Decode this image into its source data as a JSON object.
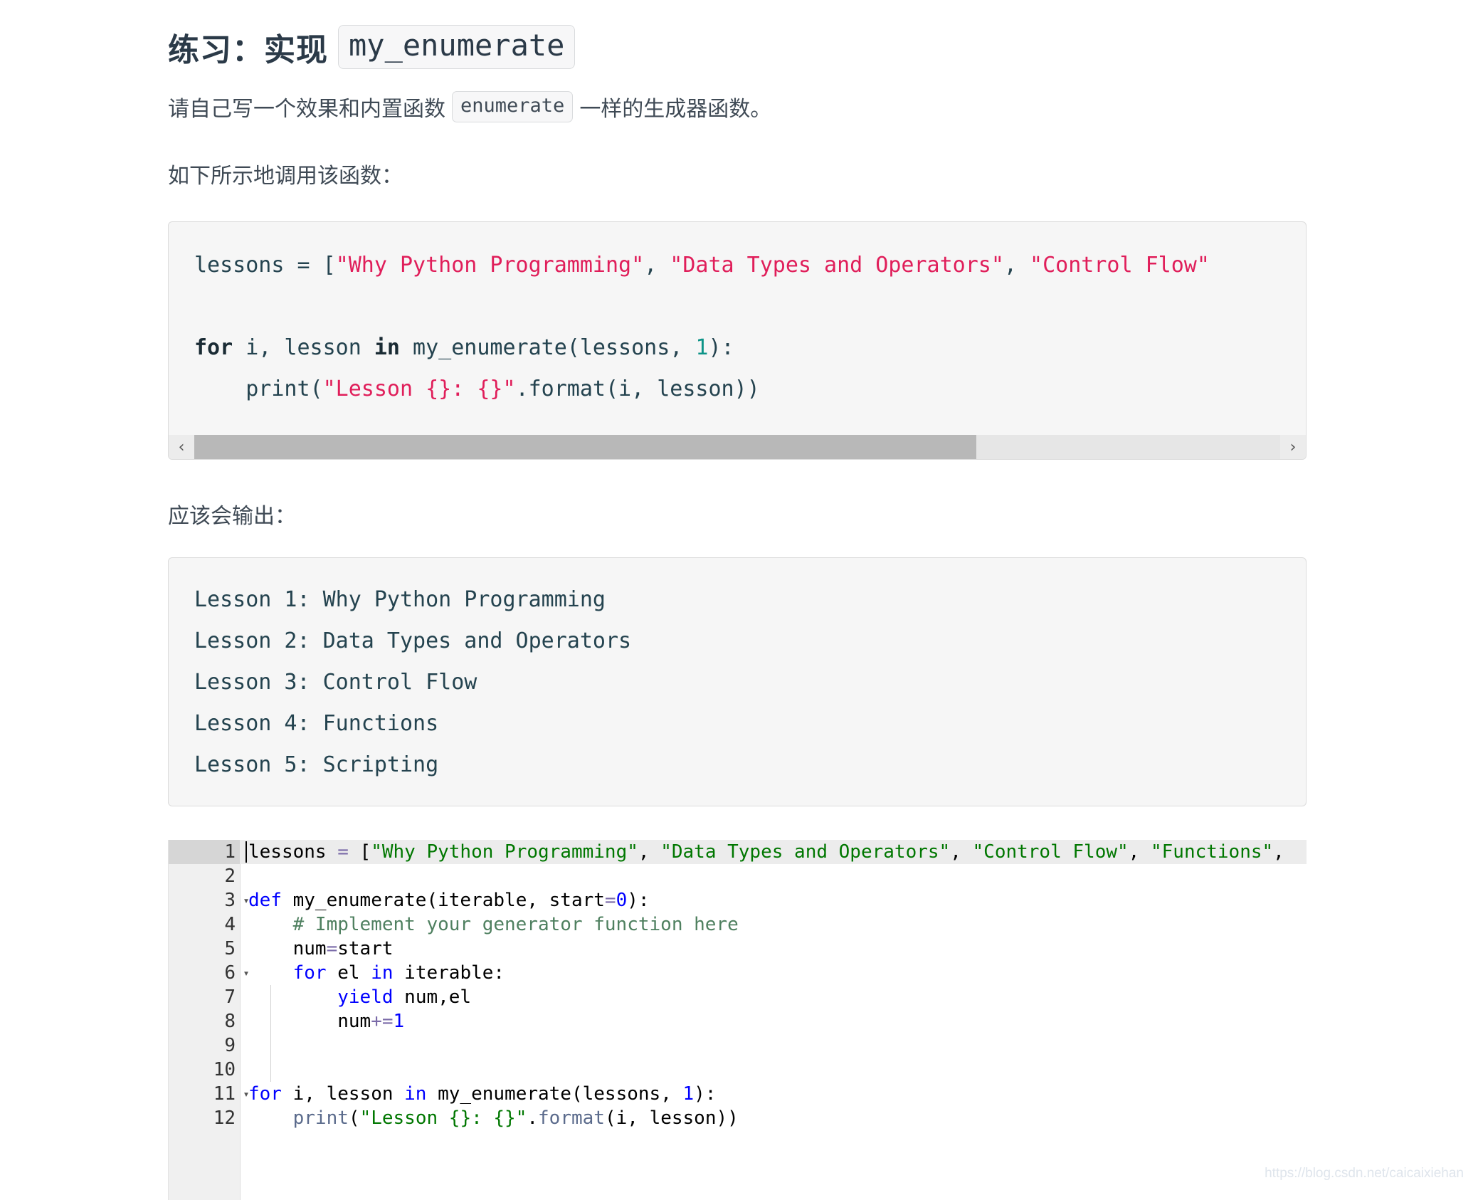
{
  "heading": {
    "text": "练习：实现",
    "code": "my_enumerate"
  },
  "subheading": {
    "before": "请自己写一个效果和内置函数",
    "code": "enumerate",
    "after": "一样的生成器函数。"
  },
  "paragraphs": {
    "call": "如下所示地调用该函数：",
    "output": "应该会输出："
  },
  "code_block_1": {
    "line1": {
      "a": "lessons = [",
      "b": "\"Why Python Programming\"",
      "c": ", ",
      "d": "\"Data Types and Operators\"",
      "e": ", ",
      "f": "\"Control Flow\""
    },
    "line3": {
      "kw_for": "for",
      "mid": " i, lesson ",
      "kw_in": "in",
      "call": " my_enumerate(lessons, ",
      "num": "1",
      "tail": "):"
    },
    "line4": {
      "a": "    print(",
      "b": "\"Lesson {}: {}\"",
      "c": ".format(i, lesson))"
    },
    "scrollbar": {
      "left_arrow": "‹",
      "right_arrow": "›",
      "thumb_percent": 72
    }
  },
  "output_block": {
    "lines": [
      "Lesson 1: Why Python Programming",
      "Lesson 2: Data Types and Operators",
      "Lesson 3: Control Flow",
      "Lesson 4: Functions",
      "Lesson 5: Scripting"
    ]
  },
  "editor": {
    "current_line": 1,
    "lines": [
      {
        "num": "1",
        "fold": "",
        "tokens": [
          {
            "t": "lessons ",
            "c": "e-txt"
          },
          {
            "t": "=",
            "c": "e-op"
          },
          {
            "t": " [",
            "c": "e-txt"
          },
          {
            "t": "\"Why Python Programming\"",
            "c": "e-str"
          },
          {
            "t": ", ",
            "c": "e-txt"
          },
          {
            "t": "\"Data Types and Operators\"",
            "c": "e-str"
          },
          {
            "t": ", ",
            "c": "e-txt"
          },
          {
            "t": "\"Control Flow\"",
            "c": "e-str"
          },
          {
            "t": ", ",
            "c": "e-txt"
          },
          {
            "t": "\"Functions\"",
            "c": "e-str"
          },
          {
            "t": ",",
            "c": "e-txt"
          }
        ]
      },
      {
        "num": "2",
        "fold": "",
        "tokens": []
      },
      {
        "num": "3",
        "fold": "▾",
        "tokens": [
          {
            "t": "def",
            "c": "e-kw"
          },
          {
            "t": " my_enumerate(iterable, start",
            "c": "e-txt"
          },
          {
            "t": "=",
            "c": "e-op"
          },
          {
            "t": "0",
            "c": "e-num"
          },
          {
            "t": "):",
            "c": "e-txt"
          }
        ]
      },
      {
        "num": "4",
        "fold": "",
        "tokens": [
          {
            "t": "    # Implement your generator function here",
            "c": "e-com"
          }
        ]
      },
      {
        "num": "5",
        "fold": "",
        "tokens": [
          {
            "t": "    num",
            "c": "e-txt"
          },
          {
            "t": "=",
            "c": "e-op"
          },
          {
            "t": "start",
            "c": "e-txt"
          }
        ]
      },
      {
        "num": "6",
        "fold": "▾",
        "tokens": [
          {
            "t": "    ",
            "c": "e-txt"
          },
          {
            "t": "for",
            "c": "e-kw"
          },
          {
            "t": " el ",
            "c": "e-txt"
          },
          {
            "t": "in",
            "c": "e-kw"
          },
          {
            "t": " iterable:",
            "c": "e-txt"
          }
        ]
      },
      {
        "num": "7",
        "fold": "",
        "tokens": [
          {
            "t": "        ",
            "c": "e-txt"
          },
          {
            "t": "yield",
            "c": "e-kw"
          },
          {
            "t": " num,el",
            "c": "e-txt"
          }
        ]
      },
      {
        "num": "8",
        "fold": "",
        "tokens": [
          {
            "t": "        num",
            "c": "e-txt"
          },
          {
            "t": "+=",
            "c": "e-op"
          },
          {
            "t": "1",
            "c": "e-num"
          }
        ]
      },
      {
        "num": "9",
        "fold": "",
        "tokens": []
      },
      {
        "num": "10",
        "fold": "",
        "tokens": []
      },
      {
        "num": "11",
        "fold": "▾",
        "tokens": [
          {
            "t": "for",
            "c": "e-kw"
          },
          {
            "t": " i, lesson ",
            "c": "e-txt"
          },
          {
            "t": "in",
            "c": "e-kw"
          },
          {
            "t": " my_enumerate(lessons, ",
            "c": "e-txt"
          },
          {
            "t": "1",
            "c": "e-num"
          },
          {
            "t": "):",
            "c": "e-txt"
          }
        ]
      },
      {
        "num": "12",
        "fold": "",
        "tokens": [
          {
            "t": "    ",
            "c": "e-txt"
          },
          {
            "t": "print",
            "c": "e-fn"
          },
          {
            "t": "(",
            "c": "e-txt"
          },
          {
            "t": "\"Lesson {}: {}\"",
            "c": "e-str"
          },
          {
            "t": ".",
            "c": "e-txt"
          },
          {
            "t": "format",
            "c": "e-fn"
          },
          {
            "t": "(i, lesson))",
            "c": "e-txt"
          }
        ]
      }
    ]
  },
  "watermark": "https://blog.csdn.net/caicaixiehan",
  "colors": {
    "string_red": "#e01e5a",
    "number_teal": "#0d9488",
    "editor_keyword_blue": "#0000ff",
    "editor_string_green": "#007700",
    "editor_comment_green": "#4f8060"
  }
}
